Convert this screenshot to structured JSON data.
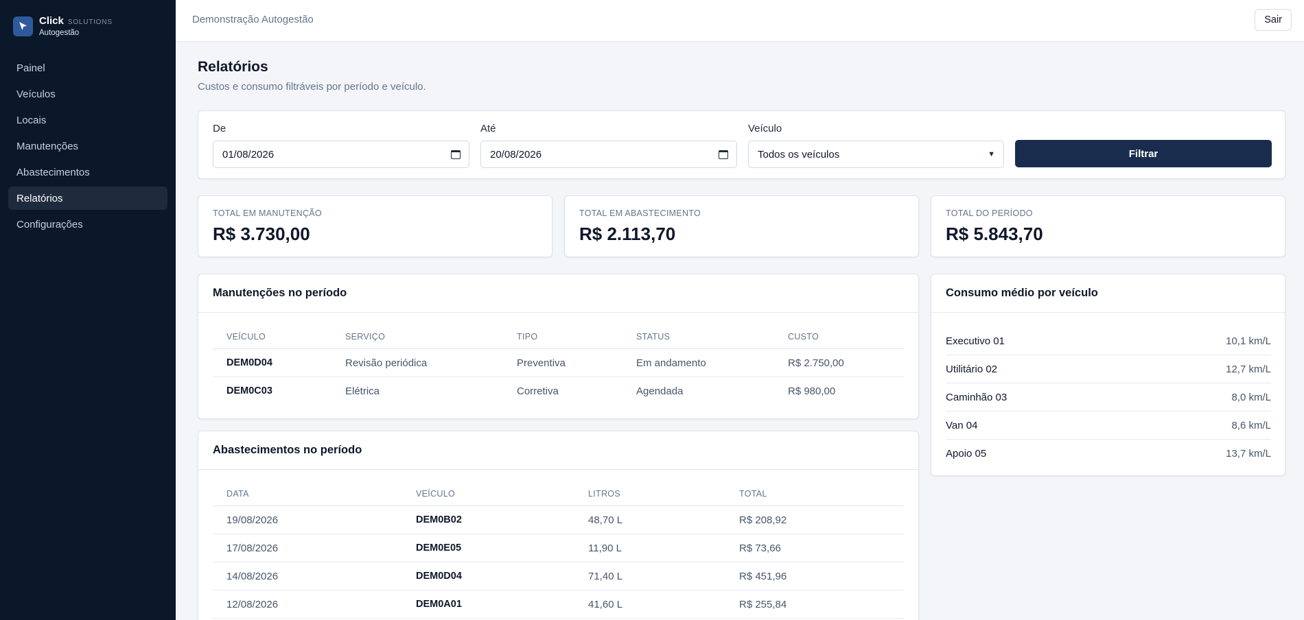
{
  "brand": {
    "name": "Click",
    "suffix": "SOLUTIONS",
    "subtitle": "Autogestão"
  },
  "sidebar": {
    "items": [
      {
        "label": "Painel",
        "active": false
      },
      {
        "label": "Veículos",
        "active": false
      },
      {
        "label": "Locais",
        "active": false
      },
      {
        "label": "Manutenções",
        "active": false
      },
      {
        "label": "Abastecimentos",
        "active": false
      },
      {
        "label": "Relatórios",
        "active": true
      },
      {
        "label": "Configurações",
        "active": false
      }
    ]
  },
  "topbar": {
    "title": "Demonstração Autogestão",
    "logout_label": "Sair"
  },
  "page": {
    "title": "Relatórios",
    "subtitle": "Custos e consumo filtráveis por período e veículo."
  },
  "filters": {
    "from_label": "De",
    "from_value": "01/08/2026",
    "to_label": "Até",
    "to_value": "20/08/2026",
    "vehicle_label": "Veículo",
    "vehicle_value": "Todos os veículos",
    "submit_label": "Filtrar"
  },
  "stats": [
    {
      "label": "TOTAL EM MANUTENÇÃO",
      "value": "R$ 3.730,00"
    },
    {
      "label": "TOTAL EM ABASTECIMENTO",
      "value": "R$ 2.113,70"
    },
    {
      "label": "TOTAL DO PERÍODO",
      "value": "R$ 5.843,70"
    }
  ],
  "maintenance": {
    "title": "Manutenções no período",
    "columns": [
      "VEÍCULO",
      "SERVIÇO",
      "TIPO",
      "STATUS",
      "CUSTO"
    ],
    "rows": [
      [
        "DEM0D04",
        "Revisão periódica",
        "Preventiva",
        "Em andamento",
        "R$ 2.750,00"
      ],
      [
        "DEM0C03",
        "Elétrica",
        "Corretiva",
        "Agendada",
        "R$ 980,00"
      ]
    ]
  },
  "fueling": {
    "title": "Abastecimentos no período",
    "columns": [
      "DATA",
      "VEÍCULO",
      "LITROS",
      "TOTAL"
    ],
    "rows": [
      [
        "19/08/2026",
        "DEM0B02",
        "48,70 L",
        "R$ 208,92"
      ],
      [
        "17/08/2026",
        "DEM0E05",
        "11,90 L",
        "R$ 73,66"
      ],
      [
        "14/08/2026",
        "DEM0D04",
        "71,40 L",
        "R$ 451,96"
      ],
      [
        "12/08/2026",
        "DEM0A01",
        "41,60 L",
        "R$ 255,84"
      ]
    ]
  },
  "consumption": {
    "title": "Consumo médio por veículo",
    "items": [
      {
        "name": "Executivo 01",
        "value": "10,1 km/L"
      },
      {
        "name": "Utilitário 02",
        "value": "12,7 km/L"
      },
      {
        "name": "Caminhão 03",
        "value": "8,0 km/L"
      },
      {
        "name": "Van 04",
        "value": "8,6 km/L"
      },
      {
        "name": "Apoio 05",
        "value": "13,7 km/L"
      }
    ]
  },
  "colors": {
    "sidebar_bg": "#0b1829",
    "accent": "#1a2c4e",
    "page_bg": "#f3f5f8"
  }
}
